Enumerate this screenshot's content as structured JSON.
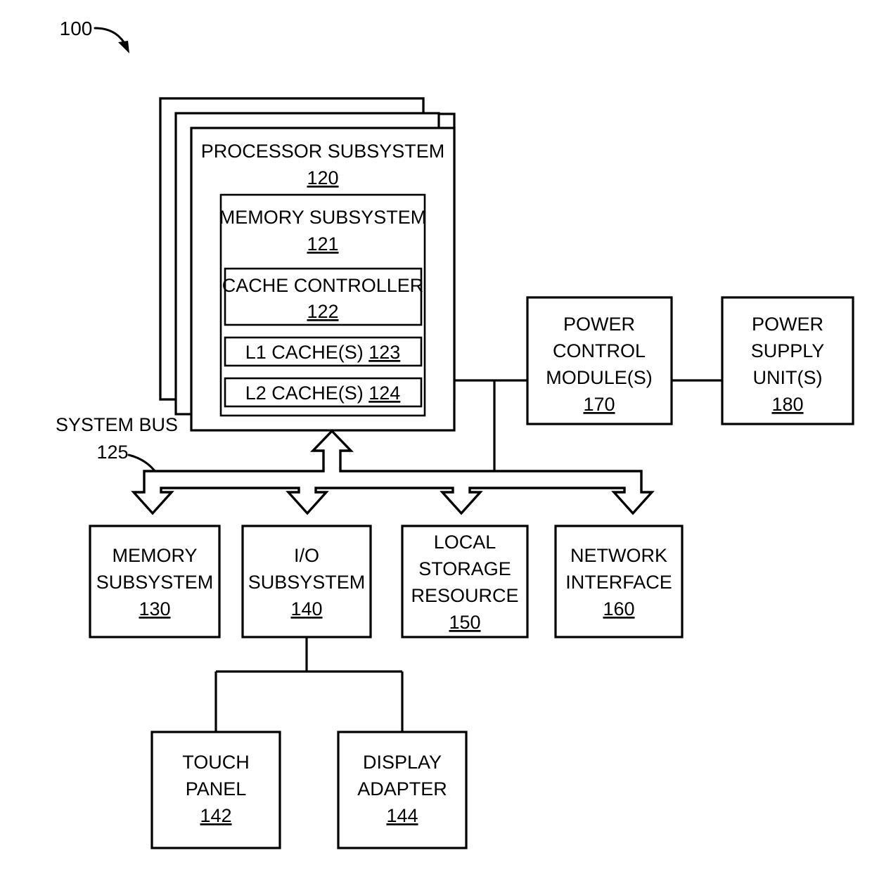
{
  "figure": {
    "reference_numeral": "100",
    "type": "block-diagram"
  },
  "bus": {
    "label": "SYSTEM BUS",
    "number": "125"
  },
  "blocks": {
    "processor_subsystem": {
      "label": "PROCESSOR SUBSYSTEM",
      "number": "120",
      "stacked": "3"
    },
    "memory_subsystem_inner": {
      "label": "MEMORY SUBSYSTEM",
      "number": "121"
    },
    "cache_controller": {
      "label": "CACHE CONTROLLER",
      "number": "122"
    },
    "l1_cache": {
      "label": "L1 CACHE(S)",
      "number": "123"
    },
    "l2_cache": {
      "label": "L2 CACHE(S)",
      "number": "124"
    },
    "power_control_module": {
      "line1": "POWER",
      "line2": "CONTROL",
      "line3": "MODULE(S)",
      "number": "170"
    },
    "power_supply_unit": {
      "line1": "POWER",
      "line2": "SUPPLY",
      "line3": "UNIT(S)",
      "number": "180"
    },
    "memory_subsystem": {
      "line1": "MEMORY",
      "line2": "SUBSYSTEM",
      "number": "130"
    },
    "io_subsystem": {
      "line1": "I/O",
      "line2": "SUBSYSTEM",
      "number": "140"
    },
    "local_storage_resource": {
      "line1": "LOCAL",
      "line2": "STORAGE",
      "line3": "RESOURCE",
      "number": "150"
    },
    "network_interface": {
      "line1": "NETWORK",
      "line2": "INTERFACE",
      "number": "160"
    },
    "touch_panel": {
      "line1": "TOUCH",
      "line2": "PANEL",
      "number": "142"
    },
    "display_adapter": {
      "line1": "DISPLAY",
      "line2": "ADAPTER",
      "number": "144"
    }
  },
  "colors": {
    "stroke": "#000000",
    "fill": "#ffffff"
  }
}
